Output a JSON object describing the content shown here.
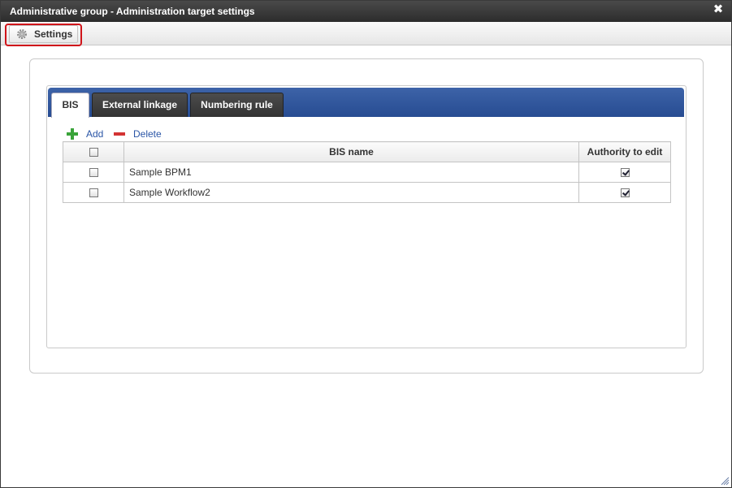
{
  "window": {
    "title": "Administrative group - Administration target settings",
    "close_icon": "close-icon"
  },
  "toolbar": {
    "settings_label": "Settings",
    "settings_icon": "gear-icon"
  },
  "tabs": [
    {
      "label": "BIS",
      "active": true
    },
    {
      "label": "External linkage",
      "active": false
    },
    {
      "label": "Numbering rule",
      "active": false
    }
  ],
  "actions": {
    "add_label": "Add",
    "delete_label": "Delete"
  },
  "table": {
    "columns": {
      "select": "",
      "name": "BIS name",
      "authority": "Authority to edit"
    },
    "header_checkbox_checked": false,
    "rows": [
      {
        "selected": false,
        "name": "Sample BPM1",
        "authority_to_edit": true
      },
      {
        "selected": false,
        "name": "Sample Workflow2",
        "authority_to_edit": true
      }
    ]
  },
  "colors": {
    "titlebar": "#333333",
    "tabbar": "#2f56a0",
    "highlight": "#d0141a",
    "link": "#2a55a6",
    "add_icon": "#3aa43a",
    "delete_icon": "#d33333"
  }
}
